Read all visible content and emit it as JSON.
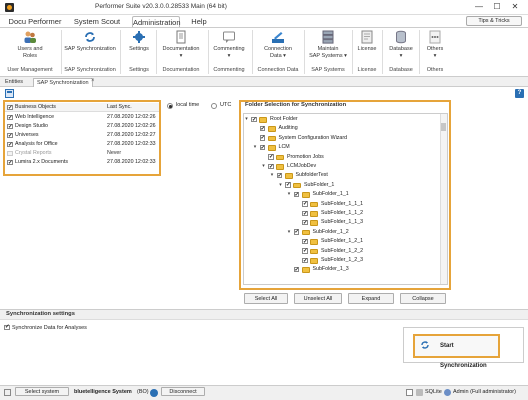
{
  "window": {
    "title": "Performer Suite v20.3.0.0.28533 Main (64 bit)",
    "minimize": "—",
    "maximize": "☐",
    "close": "✕"
  },
  "menu": {
    "items": [
      "Docu Performer",
      "System Scout",
      "Administration",
      "Help"
    ],
    "active": "Administration",
    "tips_button": "Tips & Tricks"
  },
  "ribbon": {
    "buttons": [
      {
        "label1": "Users and",
        "label2": "Roles",
        "icon": "users-icon"
      },
      {
        "label1": "SAP Synchronization",
        "label2": "",
        "icon": "sync-icon"
      },
      {
        "label1": "Settings",
        "label2": "",
        "icon": "gear-icon"
      },
      {
        "label1": "Documentation",
        "label2": "▾",
        "icon": "document-icon"
      },
      {
        "label1": "Commenting",
        "label2": "▾",
        "icon": "comment-icon"
      },
      {
        "label1": "Connection",
        "label2": "Data ▾",
        "icon": "connection-icon"
      },
      {
        "label1": "Maintain",
        "label2": "SAP Systems ▾",
        "icon": "server-icon"
      },
      {
        "label1": "License",
        "label2": "",
        "icon": "license-icon"
      },
      {
        "label1": "Database",
        "label2": "▾",
        "icon": "database-icon"
      },
      {
        "label1": "Others",
        "label2": "▾",
        "icon": "more-icon"
      }
    ],
    "groups": [
      "User Management",
      "SAP Synchronization",
      "Settings",
      "Documentation",
      "Commenting",
      "Connection Data",
      "SAP Systems",
      "License",
      "Database",
      "Others"
    ]
  },
  "tabs": [
    "Entities",
    "SAP Synchronization"
  ],
  "systems": {
    "header_name": "Business Objects",
    "header_sync": "Last Sync.",
    "rows": [
      {
        "name": "Web Intelligence",
        "sync": "27.08.2020 12:02:26",
        "checked": true
      },
      {
        "name": "Design Studio",
        "sync": "27.08.2020 12:02:26",
        "checked": true
      },
      {
        "name": "Universes",
        "sync": "27.08.2020 12:02:27",
        "checked": true
      },
      {
        "name": "Analysis for Office",
        "sync": "27.08.2020 12:02:33",
        "checked": true
      },
      {
        "name": "Crystal Reports",
        "sync": "Never",
        "checked": false
      },
      {
        "name": "Lumira 2.x Documents",
        "sync": "27.08.2020 12:02:33",
        "checked": true
      }
    ]
  },
  "time": {
    "local": "local time",
    "utc": "UTC"
  },
  "folders": {
    "title": "Folder Selection for Synchronization",
    "tree": [
      {
        "label": "Root Folder",
        "level": 0,
        "exp": "▾",
        "folder": true
      },
      {
        "label": "Auditing",
        "level": 1,
        "exp": "",
        "folder": true
      },
      {
        "label": "System Configuration Wizard",
        "level": 1,
        "exp": "",
        "folder": true
      },
      {
        "label": "LCM",
        "level": 1,
        "exp": "▾",
        "folder": true
      },
      {
        "label": "Promotion Jobs",
        "level": 2,
        "exp": "",
        "folder": true
      },
      {
        "label": "LCMJobDev",
        "level": 2,
        "exp": "▾",
        "folder": true
      },
      {
        "label": "SubfolderTest",
        "level": 3,
        "exp": "▾",
        "folder": true
      },
      {
        "label": "SubFolder_1",
        "level": 4,
        "exp": "▾",
        "folder": true
      },
      {
        "label": "SubFolder_1_1",
        "level": 5,
        "exp": "▾",
        "folder": true
      },
      {
        "label": "SubFolder_1_1_1",
        "level": 6,
        "exp": "",
        "folder": true
      },
      {
        "label": "SubFolder_1_1_2",
        "level": 6,
        "exp": "",
        "folder": true
      },
      {
        "label": "SubFolder_1_1_3",
        "level": 6,
        "exp": "",
        "folder": true
      },
      {
        "label": "SubFolder_1_2",
        "level": 5,
        "exp": "▾",
        "folder": true
      },
      {
        "label": "SubFolder_1_2_1",
        "level": 6,
        "exp": "",
        "folder": true
      },
      {
        "label": "SubFolder_1_2_2",
        "level": 6,
        "exp": "",
        "folder": true
      },
      {
        "label": "SubFolder_1_2_3",
        "level": 6,
        "exp": "",
        "folder": true
      },
      {
        "label": "SubFolder_1_3",
        "level": 5,
        "exp": "",
        "folder": true
      }
    ],
    "buttons": [
      "Select All",
      "Unselect All",
      "Expand",
      "Collapse"
    ]
  },
  "settings": {
    "title": "Synchronization settings",
    "option": "Synchronize Data for Analyses",
    "start": "Start Synchronization"
  },
  "status": {
    "select_system": "Select system",
    "system_name": "bluetelligence System",
    "system_suffix": "(BO)",
    "disconnect": "Disconnect",
    "db": "SQLite",
    "user": "Admin (Full administrator)"
  },
  "colors": {
    "highlight": "#e6a43a",
    "accent": "#2a6fb3"
  }
}
